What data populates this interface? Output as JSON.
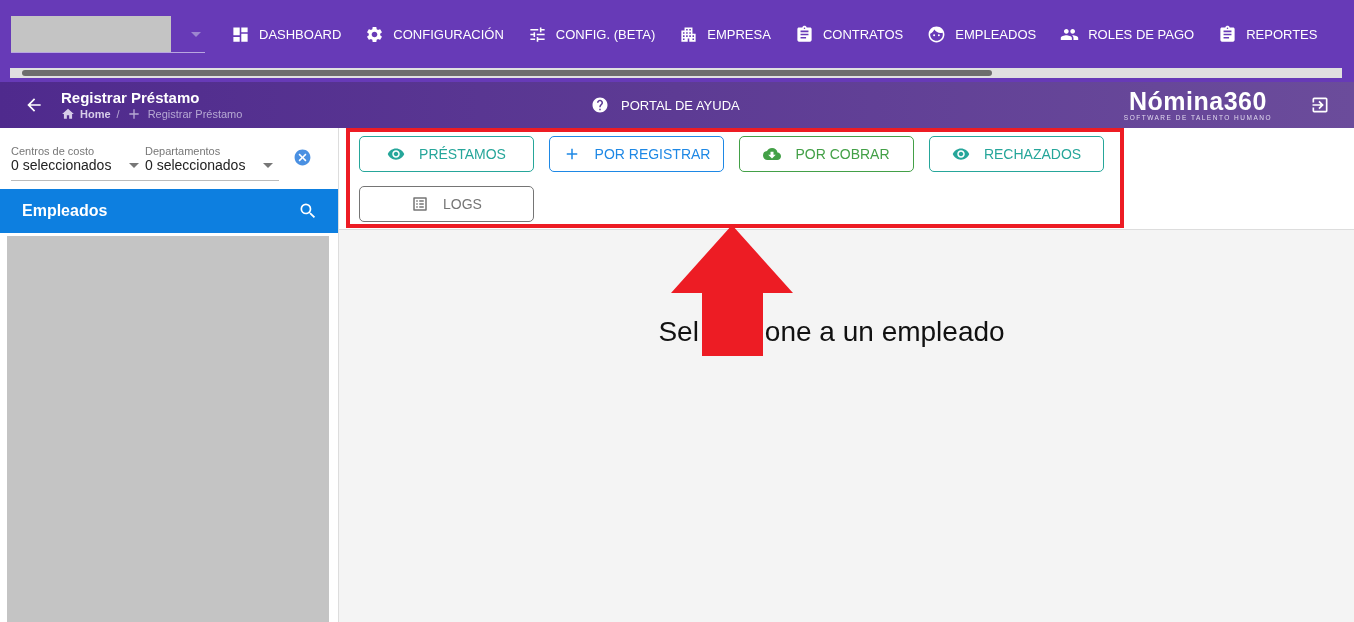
{
  "nav": {
    "items": [
      {
        "label": "DASHBOARD"
      },
      {
        "label": "CONFIGURACIÓN"
      },
      {
        "label": "CONFIG. (BETA)"
      },
      {
        "label": "EMPRESA"
      },
      {
        "label": "CONTRATOS"
      },
      {
        "label": "EMPLEADOS"
      },
      {
        "label": "ROLES DE PAGO"
      },
      {
        "label": "REPORTES"
      }
    ]
  },
  "header": {
    "title": "Registrar Préstamo",
    "breadcrumb": [
      "Home",
      "/",
      "Registrar Préstamo"
    ],
    "help": "PORTAL DE AYUDA",
    "logo": {
      "name": "Nómina360",
      "tagline": "SOFTWARE DE TALENTO HUMANO"
    }
  },
  "filters": [
    {
      "label": "Centros de costo",
      "value": "0 seleccionados"
    },
    {
      "label": "Departamentos",
      "value": "0 seleccionados"
    }
  ],
  "employees_panel": {
    "title": "Empleados"
  },
  "actions": [
    {
      "label": "PRÉSTAMOS",
      "color": "#26a69a"
    },
    {
      "label": "POR REGISTRAR",
      "color": "#1e88e5"
    },
    {
      "label": "POR COBRAR",
      "color": "#43a047"
    },
    {
      "label": "RECHAZADOS",
      "color": "#26a69a"
    },
    {
      "label": "LOGS",
      "color": "#757575"
    }
  ],
  "message": [
    "Sel",
    "one a un empleado"
  ]
}
